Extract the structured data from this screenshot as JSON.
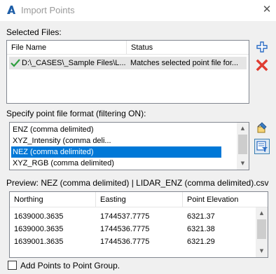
{
  "window": {
    "title": "Import Points",
    "close_glyph": "✕"
  },
  "selected_files": {
    "label": "Selected Files:",
    "columns": [
      "File Name",
      "Status"
    ],
    "rows": [
      {
        "file_name": "D:\\_CASES\\_Sample Files\\L...",
        "status": "Matches selected point file for..."
      }
    ]
  },
  "format": {
    "label": "Specify point file format (filtering ON):",
    "items": [
      "ENZ (comma delimited)",
      "XYZ_Intensity (comma deli...",
      "NEZ (comma delimited)",
      "XYZ_RGB (comma delimited)"
    ],
    "selected_index": 2
  },
  "preview": {
    "label": "Preview: NEZ (comma delimited) | LIDAR_ENZ (comma delimited).csv",
    "columns": [
      "Northing",
      "Easting",
      "Point Elevation"
    ],
    "rows": [
      [
        "1639000.3635",
        "1744537.7775",
        "6321.37"
      ],
      [
        "1639000.3635",
        "1744536.7775",
        "6321.38"
      ],
      [
        "1639001.3635",
        "1744536.7775",
        "6321.29"
      ]
    ]
  },
  "add_to_group": {
    "label": "Add Points to Point Group.",
    "checked": false
  },
  "icons": {
    "app": "autocad-a-icon",
    "add_file": "plus-icon",
    "remove_file": "red-x-icon",
    "manage_formats": "format-manager-icon",
    "filter_formats": "filter-icon",
    "status_ok": "green-check-icon"
  },
  "colors": {
    "selection": "#0078d7",
    "add_icon": "#2b6cc4",
    "remove_icon": "#e03c31",
    "check": "#2e9e3e"
  }
}
